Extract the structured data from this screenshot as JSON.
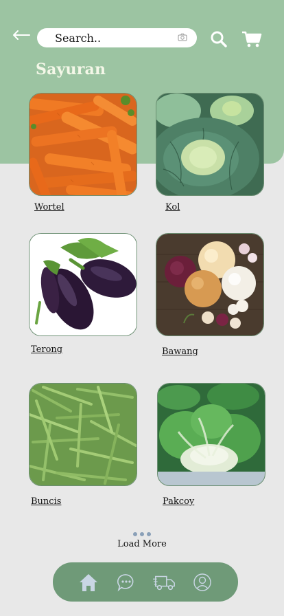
{
  "header": {
    "search": {
      "placeholder": "Search.."
    },
    "title": "Sayuran"
  },
  "products": [
    {
      "name": "Wortel",
      "image": "carrots"
    },
    {
      "name": "Kol",
      "image": "cabbage"
    },
    {
      "name": "Terong",
      "image": "eggplant"
    },
    {
      "name": "Bawang",
      "image": "onions"
    },
    {
      "name": "Buncis",
      "image": "green-beans"
    },
    {
      "name": "Pakcoy",
      "image": "bok-choy"
    }
  ],
  "load_more": {
    "label": "Load More"
  },
  "nav": {
    "items": [
      "home-icon",
      "chat-icon",
      "delivery-truck-icon",
      "profile-icon"
    ],
    "active": "home-icon"
  },
  "colors": {
    "header_green": "#9cc4a2",
    "nav_green": "#6f9a78",
    "title_cream": "#f4f7e8",
    "background": "#e8e8e8"
  }
}
